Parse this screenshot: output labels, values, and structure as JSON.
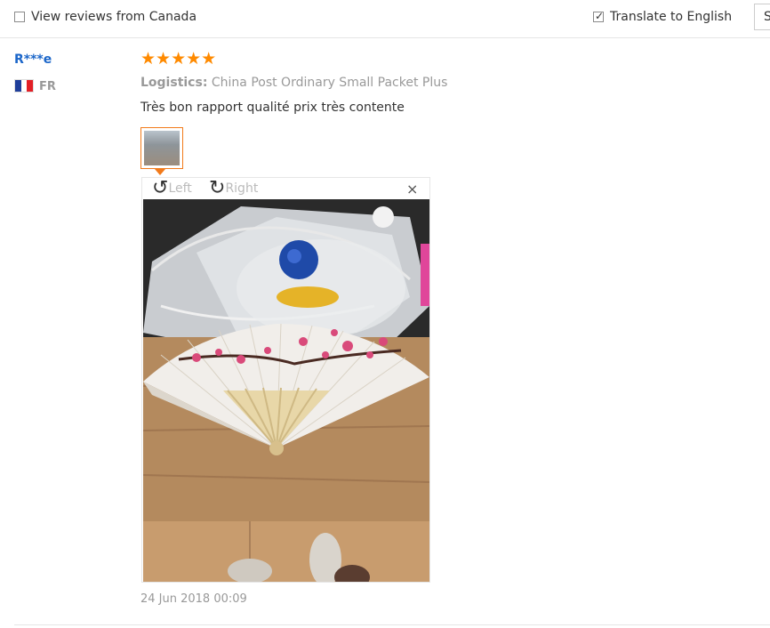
{
  "filters": {
    "view_reviews_label": "View reviews from Canada",
    "view_reviews_checked": false,
    "translate_label": "Translate to English",
    "translate_checked": true,
    "sort_label": "S"
  },
  "review": {
    "username": "R***e",
    "country": "FR",
    "flag_colors": [
      "#1f3e9a",
      "#ffffff",
      "#e21f26"
    ],
    "rating": 5,
    "stars": "★★★★★",
    "logistics_label": "Logistics:",
    "logistics_value": "China Post Ordinary Small Packet Plus",
    "text": "Très bon rapport qualité prix très contente",
    "date": "24 Jun 2018 00:09"
  },
  "viewer": {
    "rotate_left_label": "Left",
    "rotate_right_label": "Right",
    "close_glyph": "×"
  },
  "colors": {
    "accent": "#f27a1a",
    "username": "#1b66c9",
    "star": "#ff8a00",
    "muted": "#999999"
  }
}
